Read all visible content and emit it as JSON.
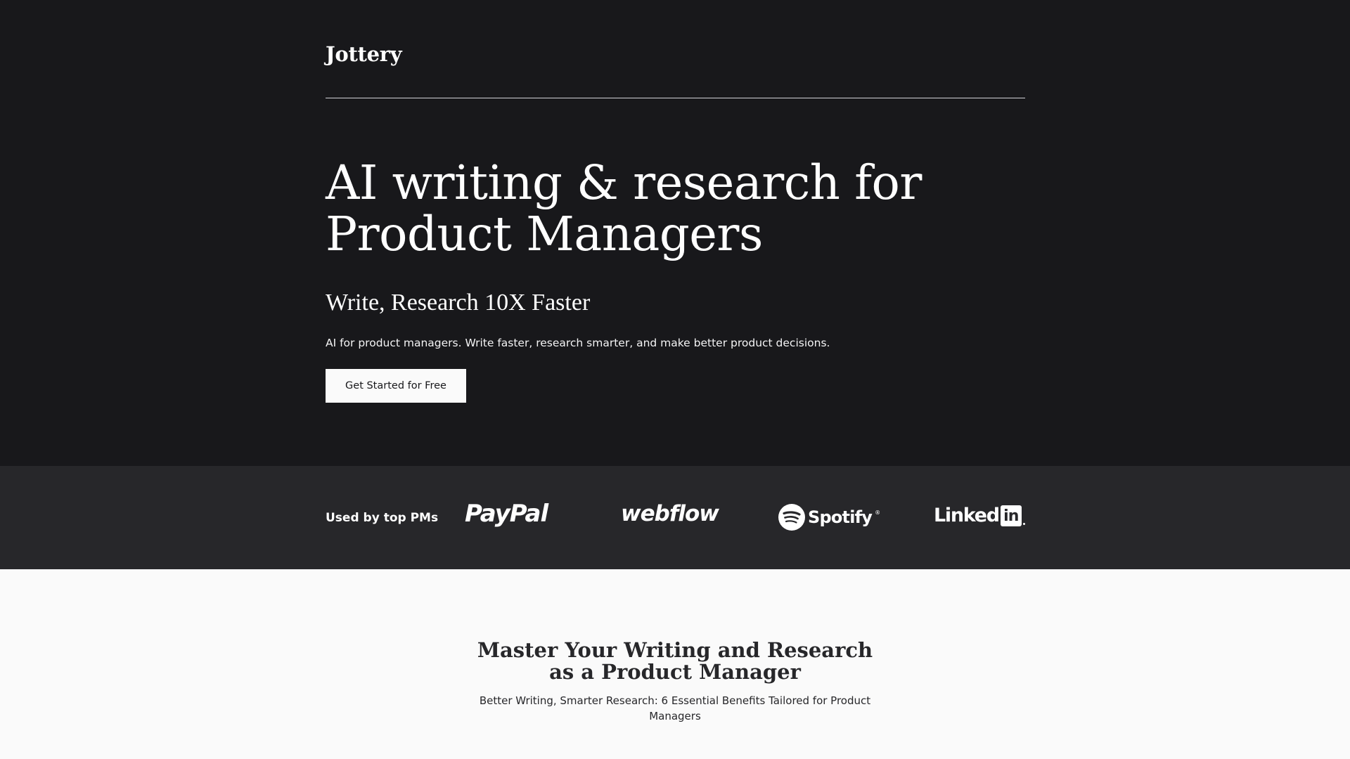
{
  "nav": {
    "logo": "Jottery"
  },
  "hero": {
    "headline": "AI writing & research for Product Managers",
    "subheadline": "Write, Research 10X Faster",
    "description": "AI for product managers. Write faster, research smarter, and make better product decisions.",
    "cta_label": "Get Started for Free"
  },
  "social_proof": {
    "label": "Used by top PMs",
    "brands": {
      "paypal": "PayPal",
      "webflow": "webflow",
      "spotify": "Spotify",
      "spotify_mark": "®",
      "linkedin_word": "Linked",
      "linkedin_box": "in"
    }
  },
  "benefits": {
    "title": "Master Your Writing and Research as a Product Manager",
    "subtitle": "Better Writing, Smarter Research: 6 Essential Benefits Tailored for Product Managers"
  },
  "colors": {
    "hero_bg": "#18181b",
    "band_bg": "#27272a",
    "page_bg": "#fafafa",
    "text_light": "#ffffff",
    "text_dark": "#27272a"
  }
}
